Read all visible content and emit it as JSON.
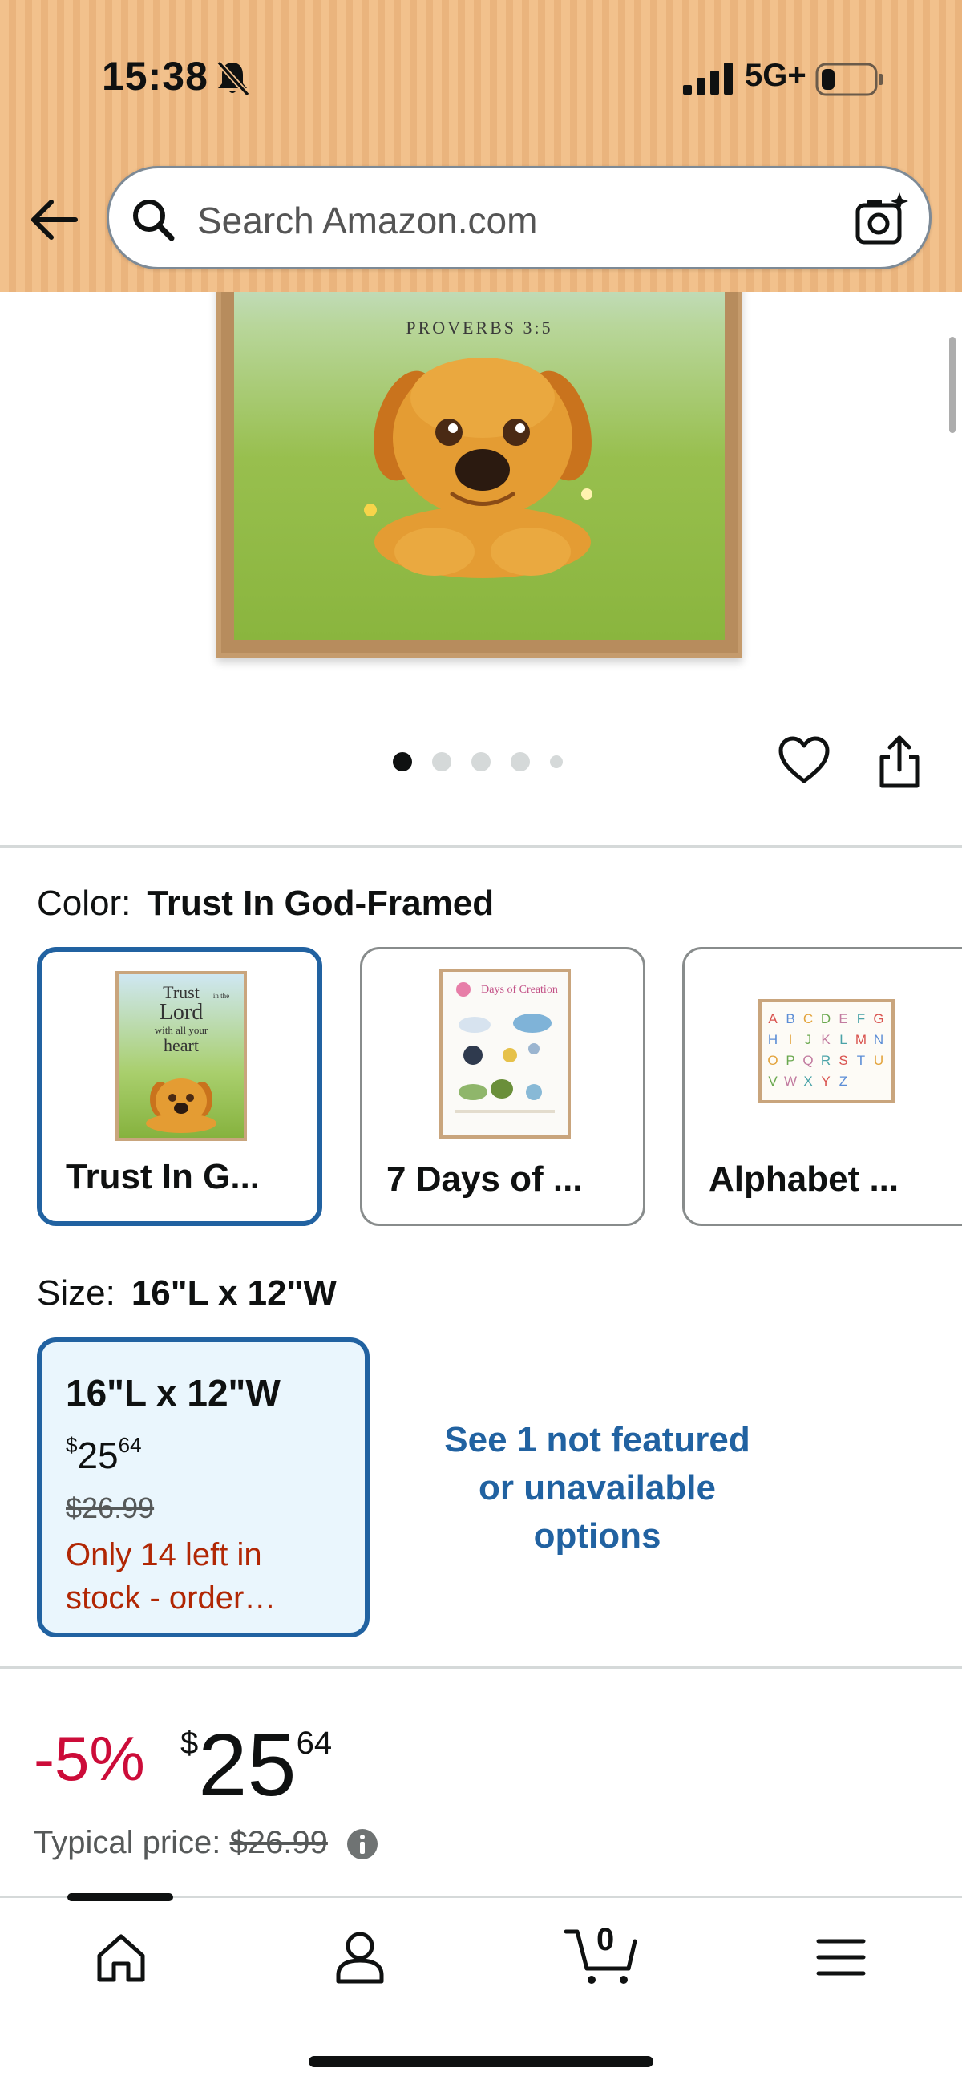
{
  "status_bar": {
    "time": "15:38",
    "network": "5G+",
    "icons": [
      "bell-slash-icon",
      "signal-icon",
      "battery-icon"
    ]
  },
  "header": {
    "search_placeholder": "Search Amazon.com",
    "icons": [
      "back-arrow-icon",
      "search-icon",
      "camera-search-icon"
    ]
  },
  "product_image": {
    "visible_text": "PROVERBS 3:5",
    "carousel": {
      "count": 5,
      "active_index": 0
    },
    "icons": [
      "heart-icon",
      "share-icon"
    ]
  },
  "color_selector": {
    "label": "Color:",
    "selected_value": "Trust In God-Framed",
    "options": [
      {
        "label": "Trust In G...",
        "selected": true,
        "thumb_text": [
          "Trust",
          "in the",
          "Lord",
          "with all your",
          "heart"
        ]
      },
      {
        "label": "7 Days of ...",
        "selected": false,
        "thumb_text": [
          "Days of Creation"
        ]
      },
      {
        "label": "Alphabet ...",
        "selected": false,
        "thumb_text": [
          "A",
          "B",
          "C",
          "D",
          "E",
          "F",
          "G",
          "H",
          "I",
          "J",
          "K",
          "L",
          "M",
          "N",
          "O",
          "P",
          "Q",
          "R",
          "S",
          "T",
          "U",
          "V",
          "W",
          "X",
          "Y",
          "Z"
        ]
      }
    ]
  },
  "size_selector": {
    "label": "Size:",
    "selected_value": "16\"L x 12\"W",
    "card": {
      "title": "16\"L x 12\"W",
      "currency": "$",
      "price_whole": "25",
      "price_fraction": "64",
      "strike_price": "$26.99",
      "stock_line1": "Only 14 left in",
      "stock_line2": "stock - order…"
    },
    "see_more": [
      "See 1 not featured",
      "or unavailable",
      "options"
    ]
  },
  "price_block": {
    "discount": "-5%",
    "currency": "$",
    "price_whole": "25",
    "price_fraction": "64",
    "typical_label": "Typical price:",
    "typical_price": "$26.99",
    "icons": [
      "info-icon"
    ]
  },
  "bottom_nav": {
    "cart_count": "0",
    "items": [
      "home-icon",
      "account-icon",
      "cart-icon",
      "menu-icon"
    ],
    "active": "home"
  },
  "colors": {
    "header_bg": "#eab47d",
    "accent_blue": "#2162a1",
    "deal_red": "#cc0c39",
    "stock_red": "#b12704",
    "selected_bg": "#eaf6fd"
  }
}
